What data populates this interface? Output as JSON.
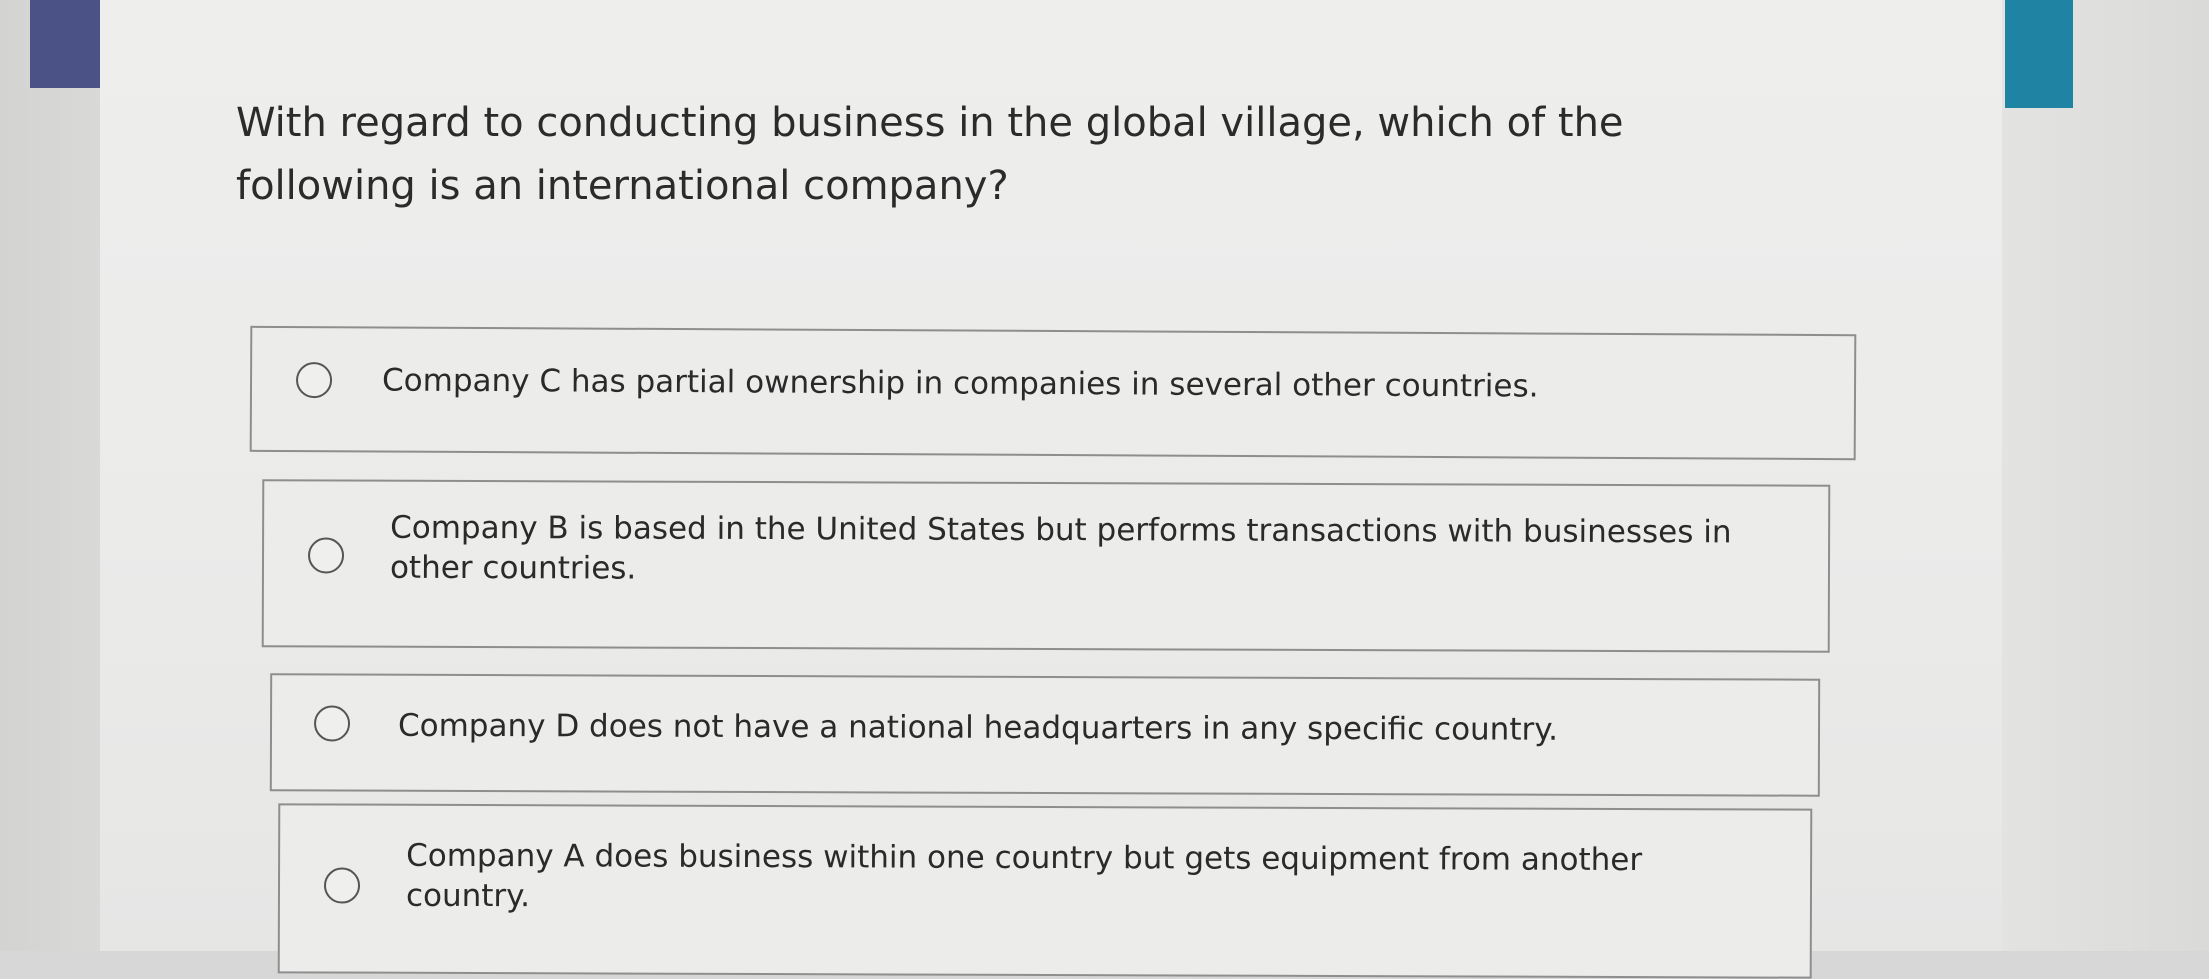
{
  "question": {
    "text": "With regard to conducting business in the global village, which of the following is an international company?"
  },
  "options": [
    {
      "label": "Company C has partial ownership in companies in several other countries.",
      "selected": false
    },
    {
      "label": "Company B is based in the United States but performs transactions with businesses in other countries.",
      "selected": false
    },
    {
      "label": "Company D does not have a national headquarters in any specific country.",
      "selected": false
    },
    {
      "label": "Company A does business within one country but gets equipment from another country.",
      "selected": false
    }
  ],
  "colors": {
    "left_accent": "#4a5286",
    "right_accent": "#1f84a3",
    "border": "#8e8e8e",
    "text": "#2b2b2b"
  }
}
